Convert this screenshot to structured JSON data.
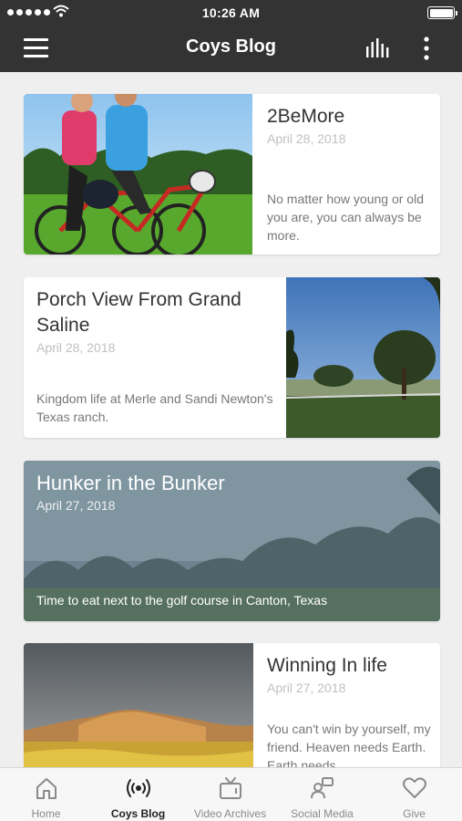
{
  "status_bar": {
    "time": "10:26 AM"
  },
  "header": {
    "title": "Coys Blog"
  },
  "posts": [
    {
      "title": "2BeMore",
      "date": "April 28, 2018",
      "excerpt": "No matter how young or old you are, you can always be more."
    },
    {
      "title": "Porch View From Grand Saline",
      "date": "April 28, 2018",
      "excerpt": "Kingdom life at Merle and Sandi Newton's Texas ranch."
    },
    {
      "title": "Hunker in the Bunker",
      "date": "April 27, 2018",
      "excerpt": "Time to eat next to the golf course in Canton, Texas"
    },
    {
      "title": "Winning In life",
      "date": "April 27, 2018",
      "excerpt": "You can't win by yourself, my friend. Heaven needs Earth. Earth needs"
    }
  ],
  "tabs": [
    {
      "label": "Home",
      "icon": "home-icon"
    },
    {
      "label": "Coys Blog",
      "icon": "broadcast-icon"
    },
    {
      "label": "Video Archives",
      "icon": "tv-icon"
    },
    {
      "label": "Social Media",
      "icon": "social-icon"
    },
    {
      "label": "Give",
      "icon": "heart-icon"
    }
  ],
  "active_tab": "Coys Blog",
  "colors": {
    "header_bg": "#333333",
    "page_bg": "#efefef",
    "active_tab": "#222222",
    "inactive_tab": "#8a8a8a"
  }
}
